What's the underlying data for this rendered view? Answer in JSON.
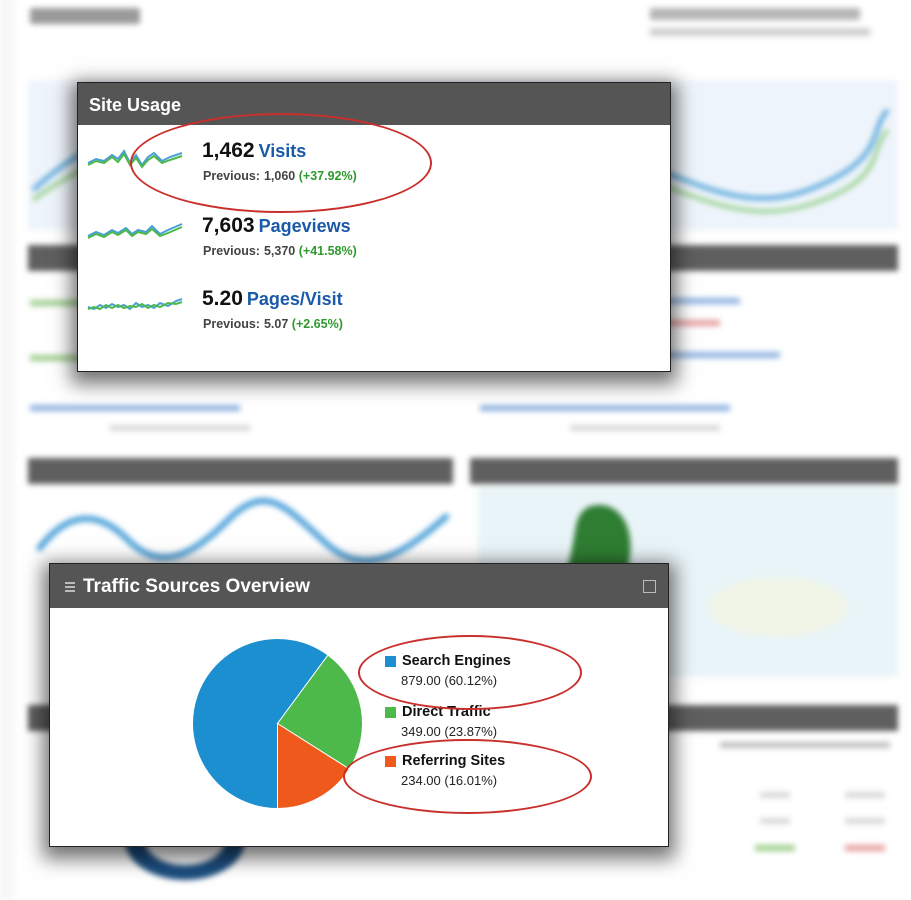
{
  "site_usage": {
    "title": "Site Usage",
    "metrics": [
      {
        "value": "1,462",
        "label": "Visits",
        "previous_label": "Previous:",
        "previous_value": "1,060",
        "change": "(+37.92%)"
      },
      {
        "value": "7,603",
        "label": "Pageviews",
        "previous_label": "Previous:",
        "previous_value": "5,370",
        "change": "(+41.58%)"
      },
      {
        "value": "5.20",
        "label": "Pages/Visit",
        "previous_label": "Previous:",
        "previous_value": "5.07",
        "change": "(+2.65%)"
      }
    ]
  },
  "traffic_sources": {
    "title": "Traffic Sources Overview",
    "sources": [
      {
        "name": "Search Engines",
        "value": "879.00 (60.12%)",
        "share": 60.12,
        "color": "#1b8fd0"
      },
      {
        "name": "Direct Traffic",
        "value": "349.00 (23.87%)",
        "share": 23.87,
        "color": "#4cb94a"
      },
      {
        "name": "Referring Sites",
        "value": "234.00 (16.01%)",
        "share": 16.01,
        "color": "#ef5a1c"
      }
    ]
  },
  "colors": {
    "panel_header": "#555555",
    "link_blue": "#1a5aa8",
    "positive_green": "#2e9a2e",
    "annotation_red": "#c9302c"
  }
}
